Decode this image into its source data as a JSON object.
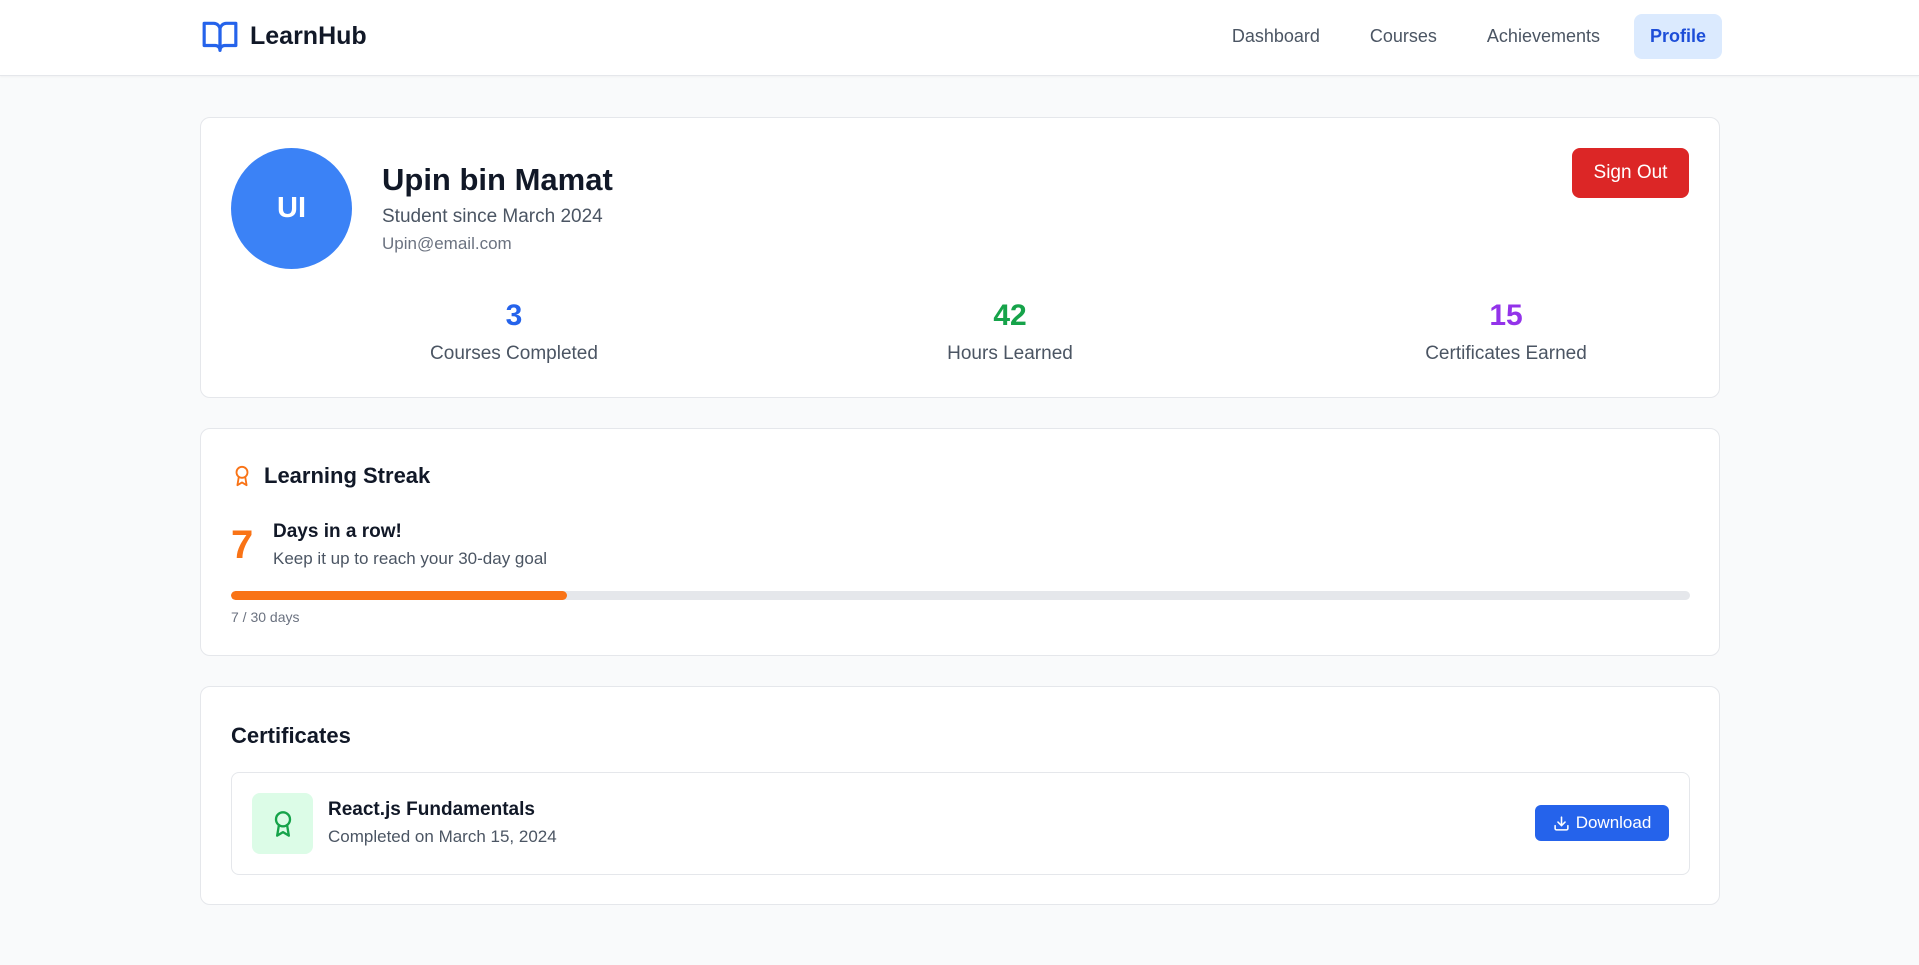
{
  "brand": {
    "name": "LearnHub",
    "icon": "book-open-icon"
  },
  "nav": {
    "items": [
      {
        "label": "Dashboard",
        "active": false
      },
      {
        "label": "Courses",
        "active": false
      },
      {
        "label": "Achievements",
        "active": false
      },
      {
        "label": "Profile",
        "active": true
      }
    ]
  },
  "profile": {
    "initials": "UI",
    "name": "Upin bin Mamat",
    "since": "Student since March 2024",
    "email": "Upin@email.com",
    "sign_out_label": "Sign Out"
  },
  "stats": [
    {
      "value": "3",
      "label": "Courses Completed",
      "color": "#2563eb"
    },
    {
      "value": "42",
      "label": "Hours Learned",
      "color": "#16a34a"
    },
    {
      "value": "15",
      "label": "Certificates Earned",
      "color": "#9333ea"
    }
  ],
  "streak": {
    "title": "Learning Streak",
    "icon": "award-icon",
    "days": "7",
    "headline": "Days in a row!",
    "subtitle": "Keep it up to reach your 30-day goal",
    "progress_fraction": 0.23,
    "progress_text": "7 / 30 days"
  },
  "certificates": {
    "title": "Certificates",
    "items": [
      {
        "name": "React.js Fundamentals",
        "date": "Completed on March 15, 2024",
        "download_label": "Download",
        "icon": "award-icon"
      }
    ]
  },
  "colors": {
    "accent": "#2563eb",
    "streak": "#f97316",
    "danger": "#dc2626",
    "avatar": "#3b82f6"
  }
}
